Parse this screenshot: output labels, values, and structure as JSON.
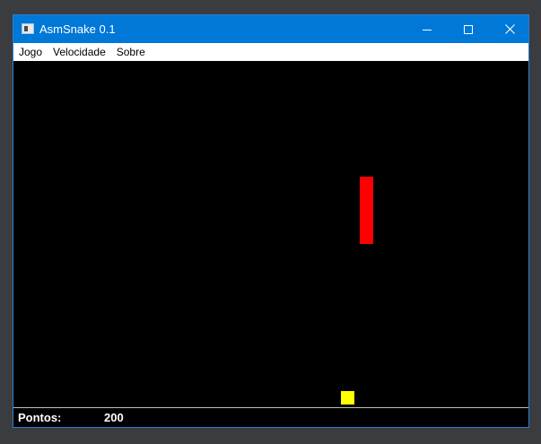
{
  "window": {
    "title": "AsmSnake 0.1",
    "icon": "app-window-icon",
    "controls": {
      "minimize_icon": "minimize-icon",
      "maximize_icon": "maximize-icon",
      "close_icon": "close-icon"
    }
  },
  "menu": {
    "items": [
      {
        "label": "Jogo"
      },
      {
        "label": "Velocidade"
      },
      {
        "label": "Sobre"
      }
    ]
  },
  "game": {
    "background_color": "#000000",
    "snake_color": "#ff0000",
    "food_color": "#ffff00",
    "grid_cell_units": 1,
    "snake_segments": [
      {
        "col": 26,
        "row": 9
      },
      {
        "col": 26,
        "row": 10
      },
      {
        "col": 26,
        "row": 11
      },
      {
        "col": 26,
        "row": 12
      },
      {
        "col": 26,
        "row": 13
      }
    ],
    "food": {
      "col": 25,
      "row": 25
    }
  },
  "status": {
    "score_label": "Pontos:",
    "score_value": "200"
  }
}
